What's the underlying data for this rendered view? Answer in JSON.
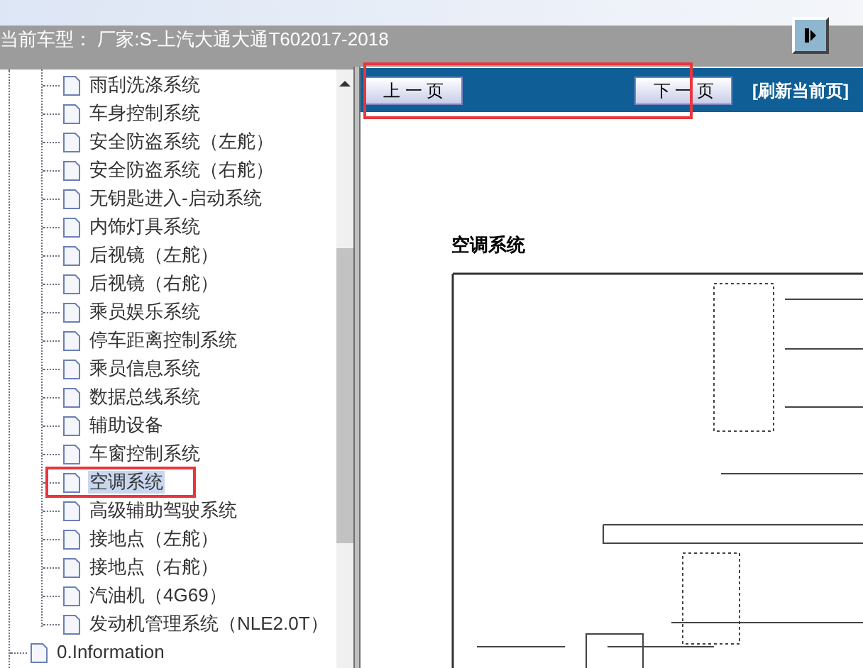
{
  "header": {
    "title": "当前车型： 厂家:S-上汽大通大通T602017-2018"
  },
  "toolbar": {
    "prev": "上 一 页",
    "next": "下 一 页",
    "refresh": "[刷新当前页]"
  },
  "tree": {
    "items": [
      {
        "label": "雨刮洗涤系统",
        "selected": false
      },
      {
        "label": "车身控制系统",
        "selected": false
      },
      {
        "label": "安全防盗系统（左舵）",
        "selected": false
      },
      {
        "label": "安全防盗系统（右舵）",
        "selected": false
      },
      {
        "label": "无钥匙进入-启动系统",
        "selected": false
      },
      {
        "label": "内饰灯具系统",
        "selected": false
      },
      {
        "label": "后视镜（左舵）",
        "selected": false
      },
      {
        "label": "后视镜（右舵）",
        "selected": false
      },
      {
        "label": "乘员娱乐系统",
        "selected": false
      },
      {
        "label": "停车距离控制系统",
        "selected": false
      },
      {
        "label": "乘员信息系统",
        "selected": false
      },
      {
        "label": "数据总线系统",
        "selected": false
      },
      {
        "label": "辅助设备",
        "selected": false
      },
      {
        "label": "车窗控制系统",
        "selected": false
      },
      {
        "label": "空调系统",
        "selected": true
      },
      {
        "label": "高级辅助驾驶系统",
        "selected": false
      },
      {
        "label": "接地点（左舵）",
        "selected": false
      },
      {
        "label": "接地点（右舵）",
        "selected": false
      },
      {
        "label": "汽油机（4G69）",
        "selected": false
      },
      {
        "label": "发动机管理系统（NLE2.0T）",
        "selected": false
      }
    ],
    "siblings": [
      {
        "label": "0.Information",
        "selected": false
      }
    ]
  },
  "document": {
    "heading": "空调系统"
  }
}
